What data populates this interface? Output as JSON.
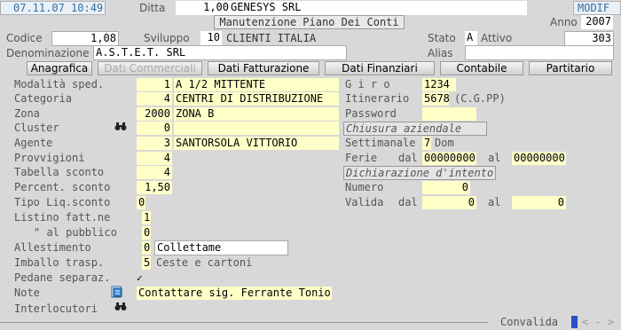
{
  "header": {
    "datetime": "07.11.07 10:49",
    "ditta_label": "Ditta",
    "ditta_code": "1,00",
    "ditta_name": "GENESYS SRL",
    "mode": "MODIF",
    "window_title": "Manutenzione Piano Dei Conti",
    "anno_label": "Anno",
    "anno_value": "2007"
  },
  "top": {
    "codice_label": "Codice",
    "codice_value": "1,08",
    "sviluppo_label": "Sviluppo",
    "sviluppo_code": "10",
    "sviluppo_desc": "CLIENTI ITALIA",
    "stato_label": "Stato",
    "stato_code": "A",
    "stato_desc": "Attivo",
    "stato_num": "303",
    "denominazione_label": "Denominazione",
    "denominazione_value": "A.S.T.E.T. SRL",
    "alias_label": "Alias",
    "alias_value": ""
  },
  "tabs": [
    {
      "label": "Anagrafica",
      "enabled": true
    },
    {
      "label": "Dati Commerciali",
      "enabled": false
    },
    {
      "label": "Dati Fatturazione",
      "enabled": true
    },
    {
      "label": "Dati Finanziari",
      "enabled": true
    },
    {
      "label": "Contabile",
      "enabled": true
    },
    {
      "label": "Partitario",
      "enabled": true
    }
  ],
  "left": {
    "modalita_label": "Modalità sped.",
    "modalita_code": "1",
    "modalita_desc": "A 1/2 MITTENTE",
    "categoria_label": "Categoria",
    "categoria_code": "4",
    "categoria_desc": "CENTRI DI DISTRIBUZIONE",
    "zona_label": "Zona",
    "zona_code": "2000",
    "zona_desc": "ZONA B",
    "cluster_label": "Cluster",
    "cluster_code": "0",
    "cluster_desc": "",
    "agente_label": "Agente",
    "agente_code": "3",
    "agente_desc": "SANTORSOLA VITTORIO",
    "provvigioni_label": "Provvigioni",
    "provvigioni_value": "4",
    "tabella_label": "Tabella  sconto",
    "tabella_value": "4",
    "percent_label": "Percent. sconto",
    "percent_value": "1,50",
    "tipoliq_label": "Tipo Liq.sconto",
    "tipoliq_value": "0",
    "listino_label": "Listino fatt.ne",
    "listino_value": "1",
    "pubblico_label": "\"  al pubblico",
    "pubblico_value": "0",
    "allestimento_label": "Allestimento",
    "allestimento_code": "0",
    "allestimento_desc": "Collettame",
    "imballo_label": "Imballo trasp.",
    "imballo_code": "5",
    "imballo_desc": "Ceste e cartoni",
    "pedane_label": "Pedane separaz.",
    "pedane_value": "✓",
    "note_label": "Note",
    "note_value": "Contattare sig. Ferrante Tonio",
    "interlocutori_label": "Interlocutori"
  },
  "right": {
    "giro_label": "G i r o",
    "giro_value": "1234",
    "itinerario_label": "Itinerario",
    "itinerario_code": "5678",
    "itinerario_desc": "(C.G.PP)",
    "password_label": "Password",
    "password_value": "",
    "chiusura_label": "Chiusura aziendale",
    "settimanale_label": "Settimanale",
    "settimanale_code": "7",
    "settimanale_desc": "Dom",
    "ferie_label": "Ferie",
    "ferie_dal_label": "dal",
    "ferie_dal_value": "00000000",
    "ferie_al_label": "al",
    "ferie_al_value": "00000000",
    "intento_label": "Dichiarazione d'intento",
    "numero_label": "Numero",
    "numero_value": "0",
    "valida_label": "Valida",
    "valida_dal_label": "dal",
    "valida_dal_value": "0",
    "valida_al_label": "al",
    "valida_al_value": "0"
  },
  "footer": {
    "convalida_label": "Convalida",
    "nav_label": "< - >"
  },
  "icons": {
    "binoculars": "binoculars-icon",
    "note": "note-icon"
  }
}
